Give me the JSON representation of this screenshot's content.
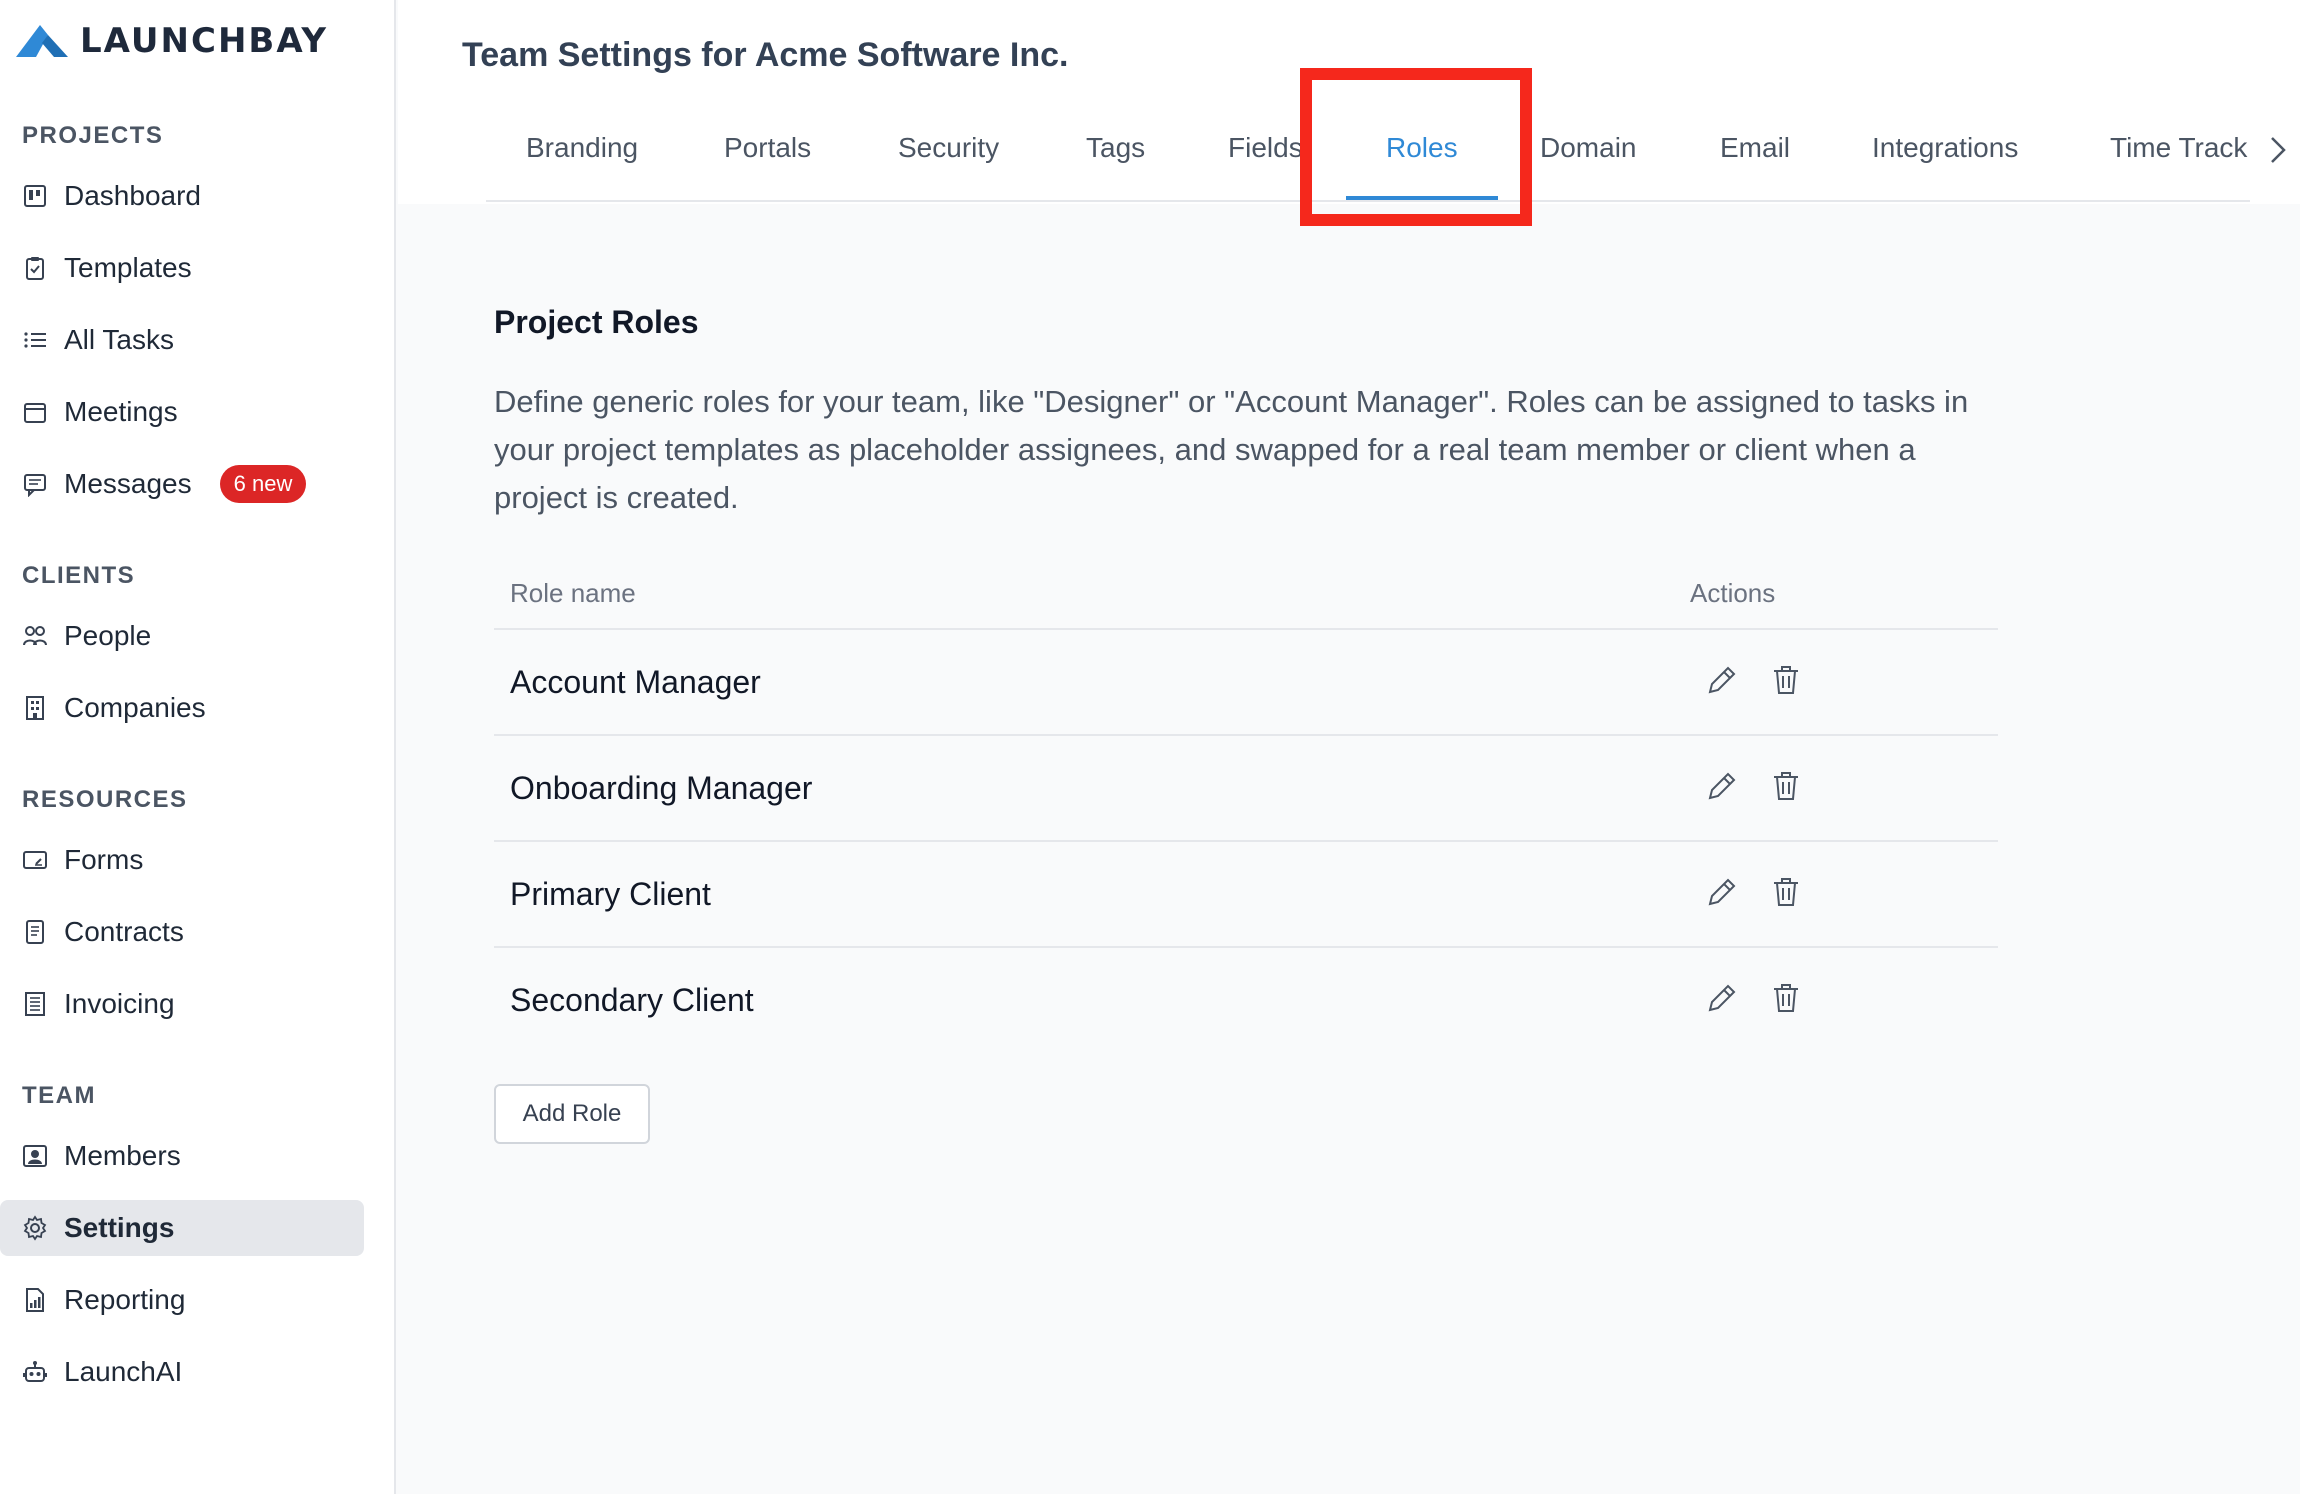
{
  "brand": {
    "name": "LAUNCHBAY",
    "accent": "#2f89d6"
  },
  "sidebar": {
    "sections": [
      {
        "label": "PROJECTS",
        "items": [
          {
            "label": "Dashboard",
            "icon": "dashboard-icon"
          },
          {
            "label": "Templates",
            "icon": "clipboard-icon"
          },
          {
            "label": "All Tasks",
            "icon": "list-icon"
          },
          {
            "label": "Meetings",
            "icon": "calendar-icon"
          },
          {
            "label": "Messages",
            "icon": "message-icon",
            "badge": "6 new"
          }
        ]
      },
      {
        "label": "CLIENTS",
        "items": [
          {
            "label": "People",
            "icon": "people-icon"
          },
          {
            "label": "Companies",
            "icon": "building-icon"
          }
        ]
      },
      {
        "label": "RESOURCES",
        "items": [
          {
            "label": "Forms",
            "icon": "form-icon"
          },
          {
            "label": "Contracts",
            "icon": "document-icon"
          },
          {
            "label": "Invoicing",
            "icon": "invoice-icon"
          }
        ]
      },
      {
        "label": "TEAM",
        "items": [
          {
            "label": "Members",
            "icon": "member-icon"
          },
          {
            "label": "Settings",
            "icon": "gear-icon",
            "active": true
          },
          {
            "label": "Reporting",
            "icon": "report-icon"
          },
          {
            "label": "LaunchAI",
            "icon": "robot-icon"
          }
        ]
      }
    ]
  },
  "header": {
    "title": "Team Settings for Acme Software Inc.",
    "tabs": [
      {
        "label": "Branding"
      },
      {
        "label": "Portals"
      },
      {
        "label": "Security"
      },
      {
        "label": "Tags"
      },
      {
        "label": "Fields"
      },
      {
        "label": "Roles",
        "active": true
      },
      {
        "label": "Domain"
      },
      {
        "label": "Email"
      },
      {
        "label": "Integrations"
      },
      {
        "label": "Time Tracking"
      }
    ]
  },
  "main": {
    "section_title": "Project Roles",
    "description": "Define generic roles for your team, like \"Designer\" or \"Account Manager\". Roles can be assigned to tasks in your project templates as placeholder assignees, and swapped for a real team member or client when a project is created.",
    "table": {
      "columns": [
        "Role name",
        "Actions"
      ],
      "rows": [
        {
          "name": "Account Manager"
        },
        {
          "name": "Onboarding Manager"
        },
        {
          "name": "Primary Client"
        },
        {
          "name": "Secondary Client"
        }
      ]
    },
    "add_button": "Add Role"
  }
}
